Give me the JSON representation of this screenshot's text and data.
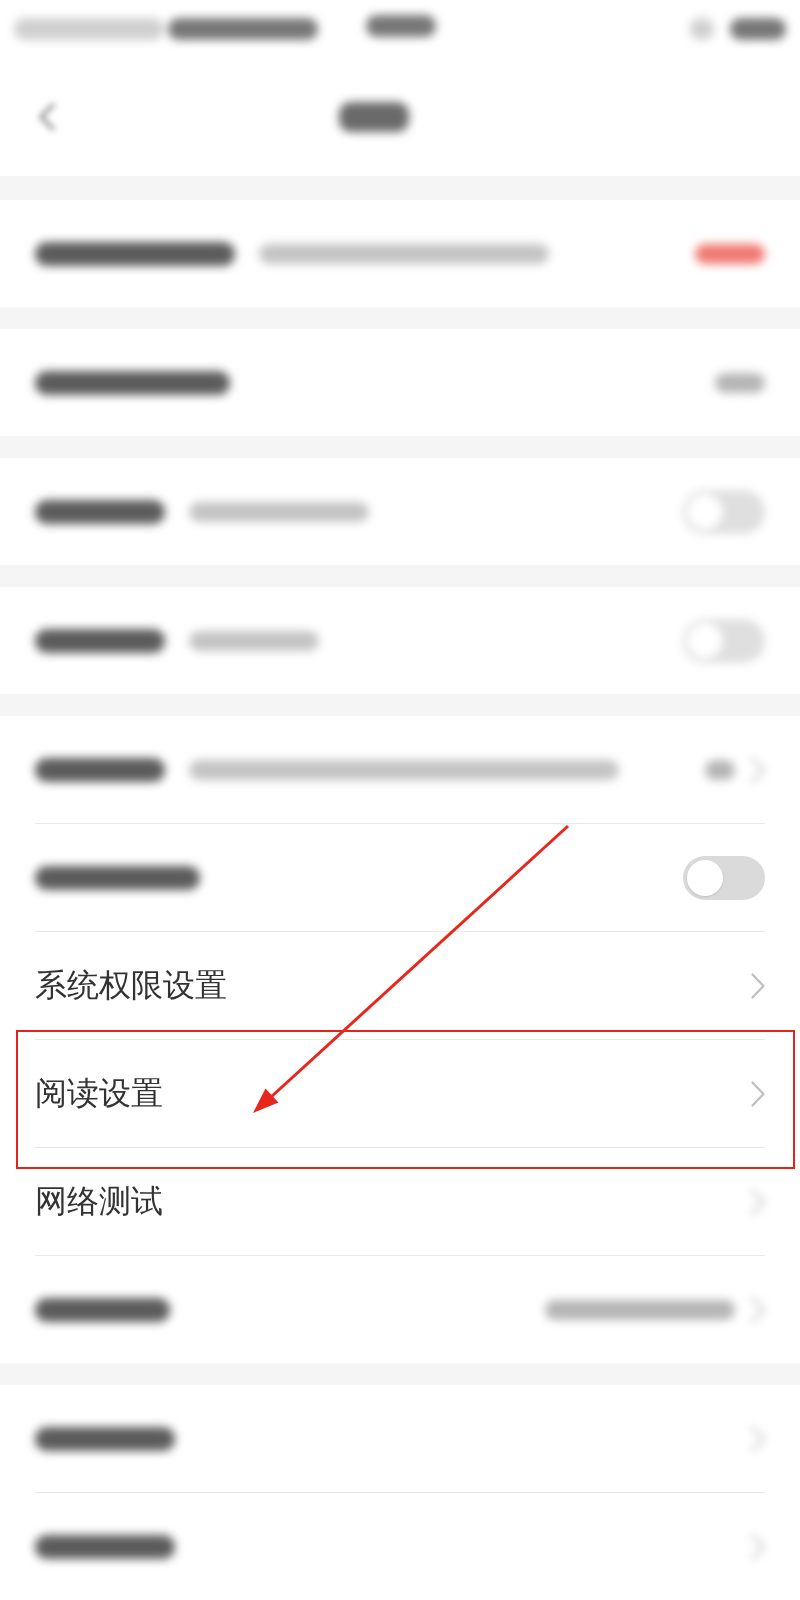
{
  "sections": [
    {
      "rows": [
        {
          "kind": "blurred-note",
          "trailing": {
            "kind": "value",
            "highlight": true,
            "blurred": true
          },
          "marked": false
        }
      ]
    },
    {
      "rows": [
        {
          "kind": "blurred",
          "trailing": {
            "kind": "value",
            "highlight": false,
            "blurred": true
          },
          "marked": false
        }
      ]
    },
    {
      "rows": [
        {
          "kind": "blurred-note",
          "trailing": {
            "kind": "switch",
            "on": false,
            "blurred": true
          },
          "marked": false
        }
      ]
    },
    {
      "rows": [
        {
          "kind": "blurred-note",
          "trailing": {
            "kind": "switch",
            "on": false,
            "blurred": true
          },
          "marked": false
        }
      ]
    },
    {
      "rows": [
        {
          "kind": "blurred-note",
          "trailing": {
            "kind": "value-chevron",
            "highlight": false,
            "blurred": true
          },
          "marked": false
        },
        {
          "kind": "blurred",
          "trailing": {
            "kind": "switch",
            "on": false,
            "blurred": false
          },
          "marked": false
        },
        {
          "kind": "text",
          "label": "系统权限设置",
          "trailing": {
            "kind": "chevron",
            "blurred": false
          },
          "marked": false
        },
        {
          "kind": "text",
          "label": "阅读设置",
          "trailing": {
            "kind": "chevron",
            "blurred": false
          },
          "marked": true
        },
        {
          "kind": "text",
          "label": "网络测试",
          "trailing": {
            "kind": "chevron",
            "blurred": true
          },
          "marked": false
        },
        {
          "kind": "blurred",
          "trailing": {
            "kind": "value-chevron",
            "highlight": false,
            "blurred": true
          },
          "marked": false
        }
      ]
    },
    {
      "rows": [
        {
          "kind": "blurred",
          "trailing": {
            "kind": "chevron",
            "blurred": true
          },
          "marked": false
        },
        {
          "kind": "blurred",
          "trailing": {
            "kind": "chevron",
            "blurred": true
          },
          "marked": false
        }
      ]
    }
  ]
}
